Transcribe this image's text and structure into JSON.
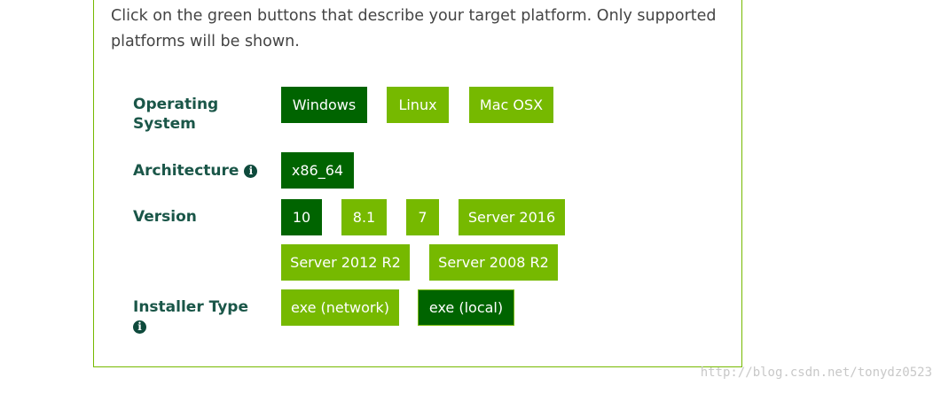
{
  "intro": "Click on the green buttons that describe your target platform. Only supported platforms will be shown.",
  "colors": {
    "accent": "#76b900",
    "selected": "#006400",
    "label": "#1a5648",
    "icon": "#0e4a3c"
  },
  "rows": {
    "os": {
      "label": "Operating System",
      "options": [
        "Windows",
        "Linux",
        "Mac OSX"
      ],
      "selected": "Windows"
    },
    "architecture": {
      "label": "Architecture",
      "options": [
        "x86_64"
      ],
      "selected": "x86_64",
      "icon": "info-icon"
    },
    "version": {
      "label": "Version",
      "options": [
        "10",
        "8.1",
        "7",
        "Server 2016",
        "Server 2012 R2",
        "Server 2008 R2"
      ],
      "selected": "10"
    },
    "installer": {
      "label": "Installer Type",
      "options": [
        "exe (network)",
        "exe (local)"
      ],
      "selected": "exe (local)",
      "icon": "info-icon"
    }
  },
  "watermark": "http://blog.csdn.net/tonydz0523"
}
